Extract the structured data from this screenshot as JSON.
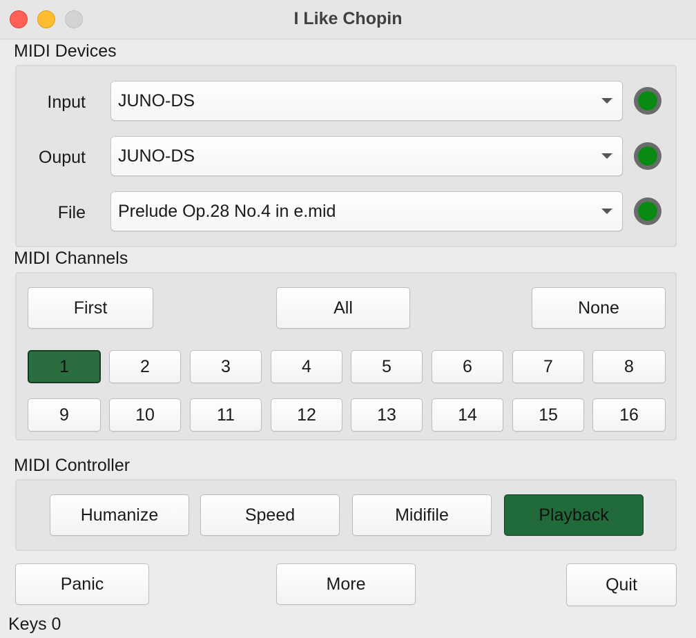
{
  "window": {
    "title": "I Like Chopin"
  },
  "devices": {
    "section_label": "MIDI Devices",
    "rows": [
      {
        "label": "Input",
        "value": "JUNO-DS",
        "led": "green"
      },
      {
        "label": "Ouput",
        "value": "JUNO-DS",
        "led": "green"
      },
      {
        "label": "File",
        "value": "Prelude Op.28 No.4 in e.mid",
        "led": "green"
      }
    ]
  },
  "channels": {
    "section_label": "MIDI Channels",
    "first_label": "First",
    "all_label": "All",
    "none_label": "None",
    "items": [
      {
        "label": "1",
        "active": true
      },
      {
        "label": "2",
        "active": false
      },
      {
        "label": "3",
        "active": false
      },
      {
        "label": "4",
        "active": false
      },
      {
        "label": "5",
        "active": false
      },
      {
        "label": "6",
        "active": false
      },
      {
        "label": "7",
        "active": false
      },
      {
        "label": "8",
        "active": false
      },
      {
        "label": "9",
        "active": false
      },
      {
        "label": "10",
        "active": false
      },
      {
        "label": "11",
        "active": false
      },
      {
        "label": "12",
        "active": false
      },
      {
        "label": "13",
        "active": false
      },
      {
        "label": "14",
        "active": false
      },
      {
        "label": "15",
        "active": false
      },
      {
        "label": "16",
        "active": false
      }
    ]
  },
  "controller": {
    "section_label": "MIDI Controller",
    "buttons": [
      {
        "label": "Humanize",
        "active": false
      },
      {
        "label": "Speed",
        "active": false
      },
      {
        "label": "Midifile",
        "active": false
      },
      {
        "label": "Playback",
        "active": true
      }
    ]
  },
  "footer": {
    "panic_label": "Panic",
    "more_label": "More",
    "quit_label": "Quit"
  },
  "status": {
    "text": "Keys 0"
  },
  "colors": {
    "active_green": "#216b3a",
    "led_green": "#0a8a12"
  }
}
